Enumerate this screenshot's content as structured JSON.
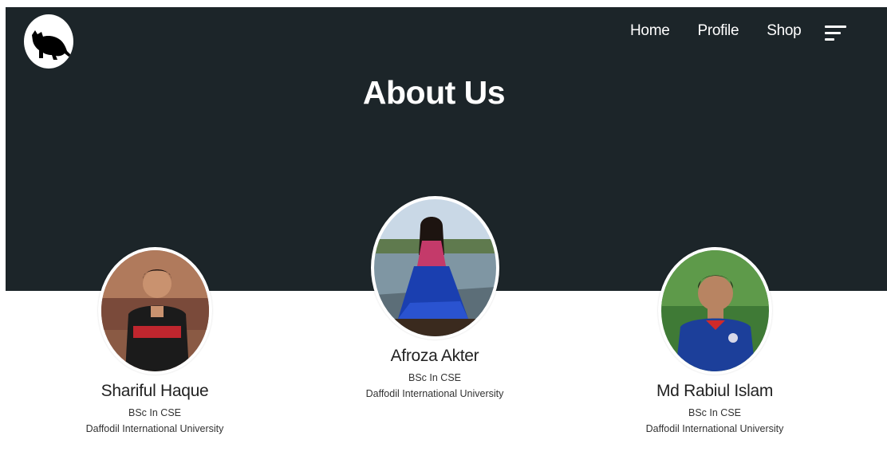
{
  "nav": {
    "items": [
      {
        "label": "Home"
      },
      {
        "label": "Profile"
      },
      {
        "label": "Shop"
      }
    ]
  },
  "hero": {
    "title": "About Us"
  },
  "members": [
    {
      "name": "Shariful Haque",
      "degree": "BSc In CSE",
      "university": "Daffodil International University"
    },
    {
      "name": "Afroza Akter",
      "degree": "BSc In CSE",
      "university": "Daffodil International University"
    },
    {
      "name": "Md Rabiul Islam",
      "degree": "BSc In CSE",
      "university": "Daffodil International University"
    }
  ],
  "colors": {
    "hero_bg": "#1c2529",
    "text_light": "#ffffff",
    "text_dark": "#222222"
  },
  "icons": {
    "logo": "cat-logo-icon",
    "menu": "menu-icon"
  }
}
